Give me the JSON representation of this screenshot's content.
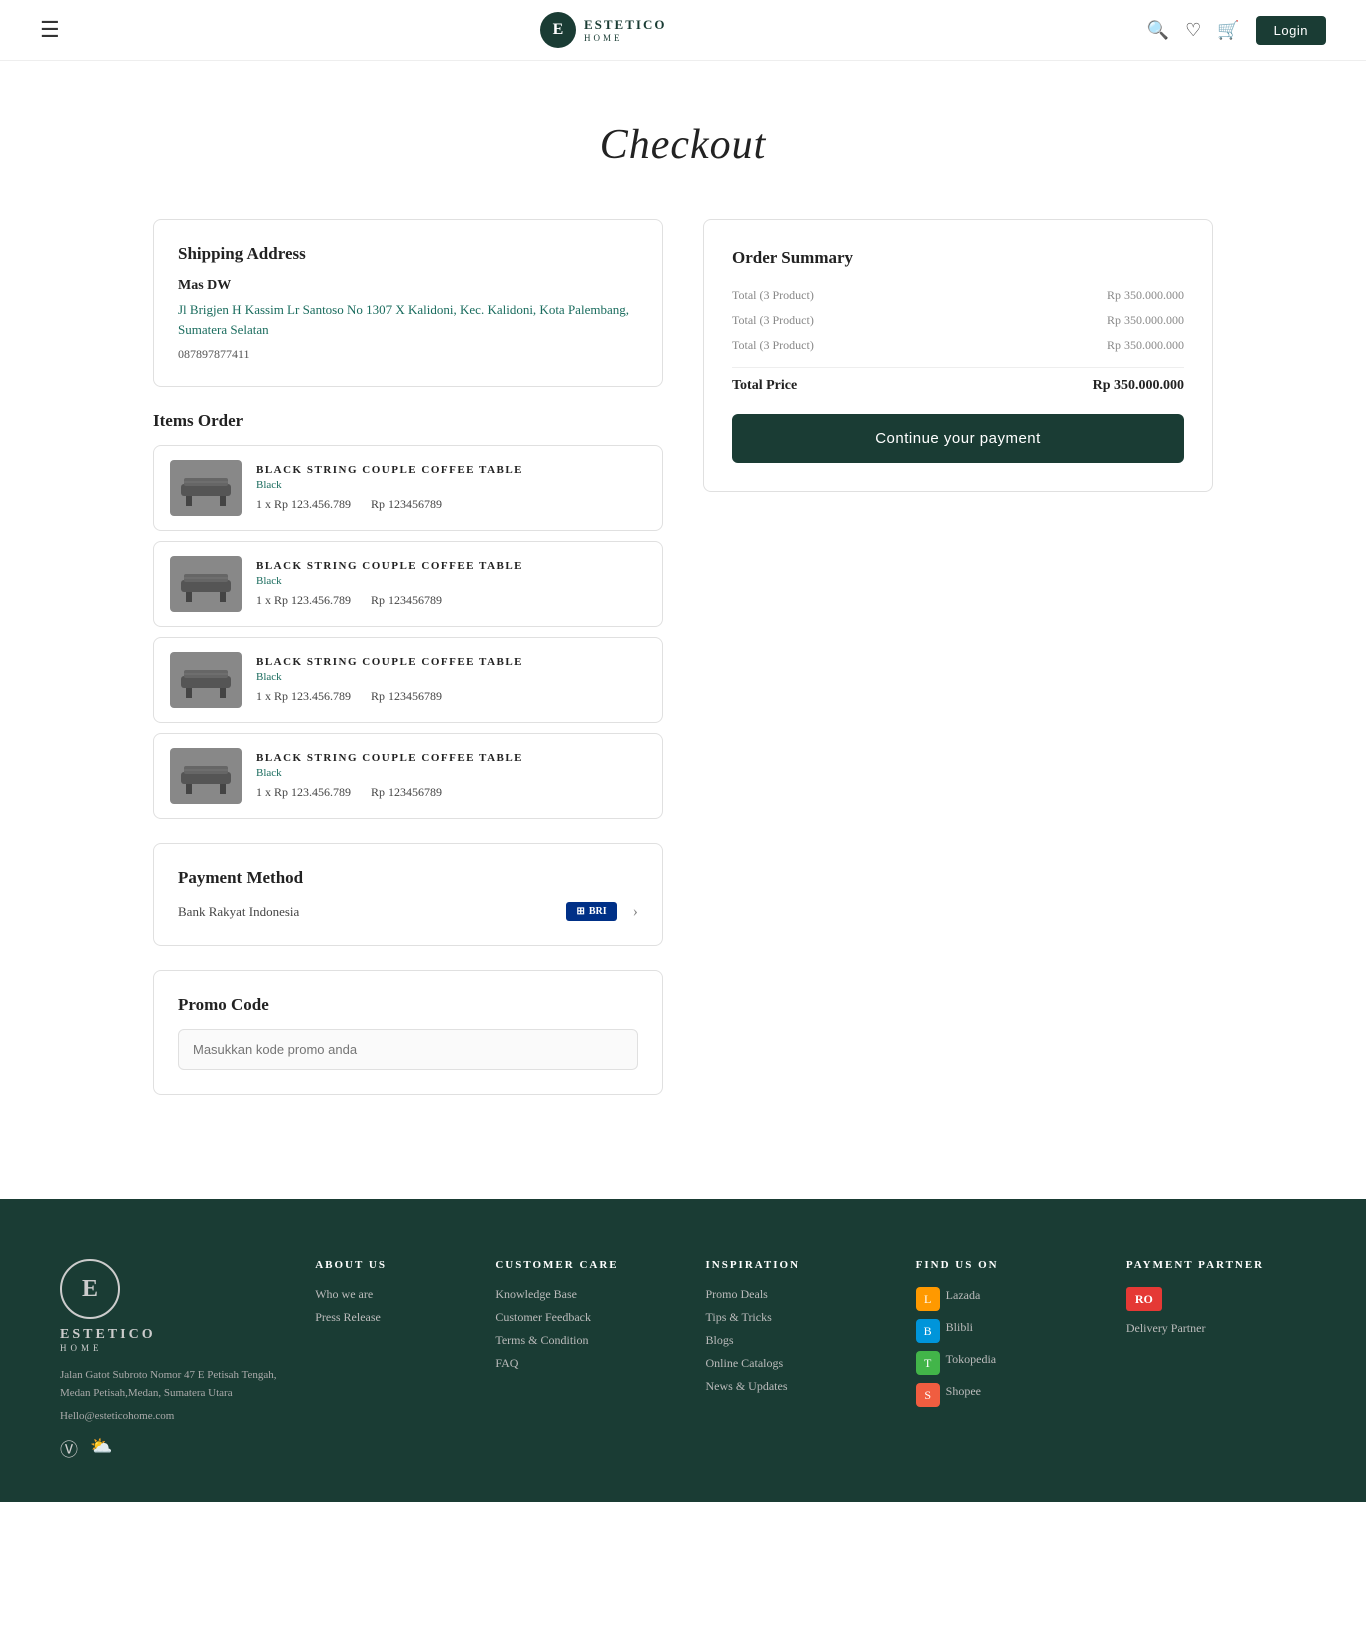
{
  "navbar": {
    "logo_letter": "E",
    "logo_name": "ESTETICO",
    "logo_sub": "HOME",
    "login_label": "Login"
  },
  "page": {
    "title": "Checkout"
  },
  "shipping": {
    "section_title": "Shipping Address",
    "customer_name": "Mas DW",
    "address": "Jl Brigjen H Kassim Lr Santoso No 1307 X Kalidoni, Kec. Kalidoni, Kota Palembang, Sumatera Selatan",
    "phone": "087897877411"
  },
  "items_order": {
    "section_title": "Items Order",
    "items": [
      {
        "name": "BLACK STRING COUPLE COFFEE TABLE",
        "color": "Black",
        "qty": "1 x Rp 123.456.789",
        "price": "Rp 123456789"
      },
      {
        "name": "BLACK STRING COUPLE COFFEE TABLE",
        "color": "Black",
        "qty": "1 x Rp 123.456.789",
        "price": "Rp 123456789"
      },
      {
        "name": "BLACK STRING COUPLE COFFEE TABLE",
        "color": "Black",
        "qty": "1 x Rp 123.456.789",
        "price": "Rp 123456789"
      },
      {
        "name": "BLACK STRING COUPLE COFFEE TABLE",
        "color": "Black",
        "qty": "1 x Rp 123.456.789",
        "price": "Rp 123456789"
      }
    ]
  },
  "payment_method": {
    "section_title": "Payment Method",
    "method_label": "Bank Rakyat Indonesia",
    "method_code": "BRI"
  },
  "promo_code": {
    "section_title": "Promo Code",
    "placeholder": "Masukkan kode promo anda"
  },
  "order_summary": {
    "title": "Order Summary",
    "rows": [
      {
        "label": "Total (3 Product)",
        "value": "Rp 350.000.000"
      },
      {
        "label": "Total (3 Product)",
        "value": "Rp 350.000.000"
      },
      {
        "label": "Total (3 Product)",
        "value": "Rp 350.000.000"
      }
    ],
    "total_label": "Total Price",
    "total_value": "Rp 350.000.000",
    "button_label": "Continue your payment"
  },
  "footer": {
    "brand_letter": "E",
    "brand_name": "ESTETICO",
    "brand_sub": "HOME",
    "brand_address": "Jalan Gatot Subroto Nomor 47 E Petisah Tengah, Medan Petisah,Medan, Sumatera Utara",
    "brand_email": "Hello@esteticohome.com",
    "about_us": {
      "title": "ABOUT US",
      "links": [
        "Who we are",
        "Press Release"
      ]
    },
    "customer_care": {
      "title": "CUSTOMER CARE",
      "links": [
        "Knowledge Base",
        "Customer Feedback",
        "Terms & Condition",
        "FAQ"
      ]
    },
    "inspiration": {
      "title": "INSPIRATION",
      "links": [
        "Promo Deals",
        "Tips & Tricks",
        "Blogs",
        "Online Catalogs",
        "News & Updates"
      ]
    },
    "find_us": {
      "title": "FIND US ON",
      "platforms": [
        "Lazada",
        "Blibli",
        "Tokopedia",
        "Shopee"
      ]
    },
    "payment_partner": {
      "title": "Payment Partner",
      "logo": "RO"
    },
    "delivery_partner": {
      "label": "Delivery Partner"
    }
  }
}
